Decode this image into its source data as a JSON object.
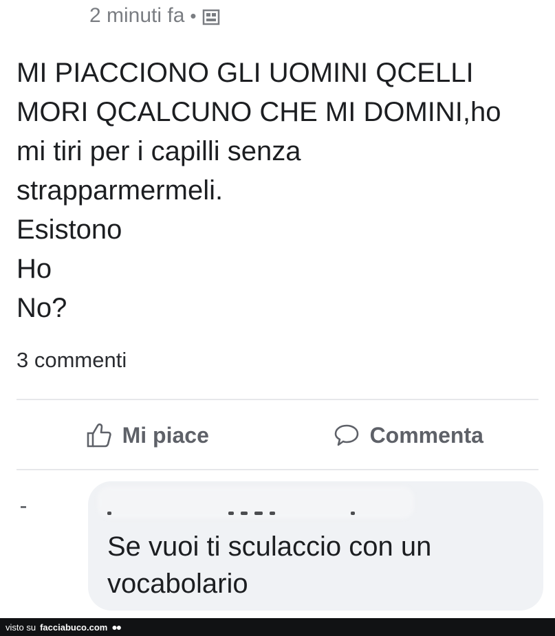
{
  "post": {
    "timestamp": "2 minuti fa",
    "separator": "•",
    "audience_icon": "photo-frame-icon",
    "lines": [
      "MI PIACCIONO GLI UOMINI QCELLI",
      "MORI QCALCUNO CHE MI DOMINI,ho",
      "mi tiri per i capilli senza",
      "strapparmermeli.",
      "Esistono",
      "Ho",
      "No?"
    ],
    "comments_count": "3 commenti"
  },
  "actions": {
    "like_label": "Mi piace",
    "like_icon": "thumbs-up-icon",
    "comment_label": "Commenta",
    "comment_icon": "speech-bubble-icon"
  },
  "comment": {
    "text_line1": "Se vuoi ti sculaccio con un",
    "text_line2": "vocabolario"
  },
  "footer": {
    "prefix": "visto su",
    "brand": "facciabuco.com"
  }
}
